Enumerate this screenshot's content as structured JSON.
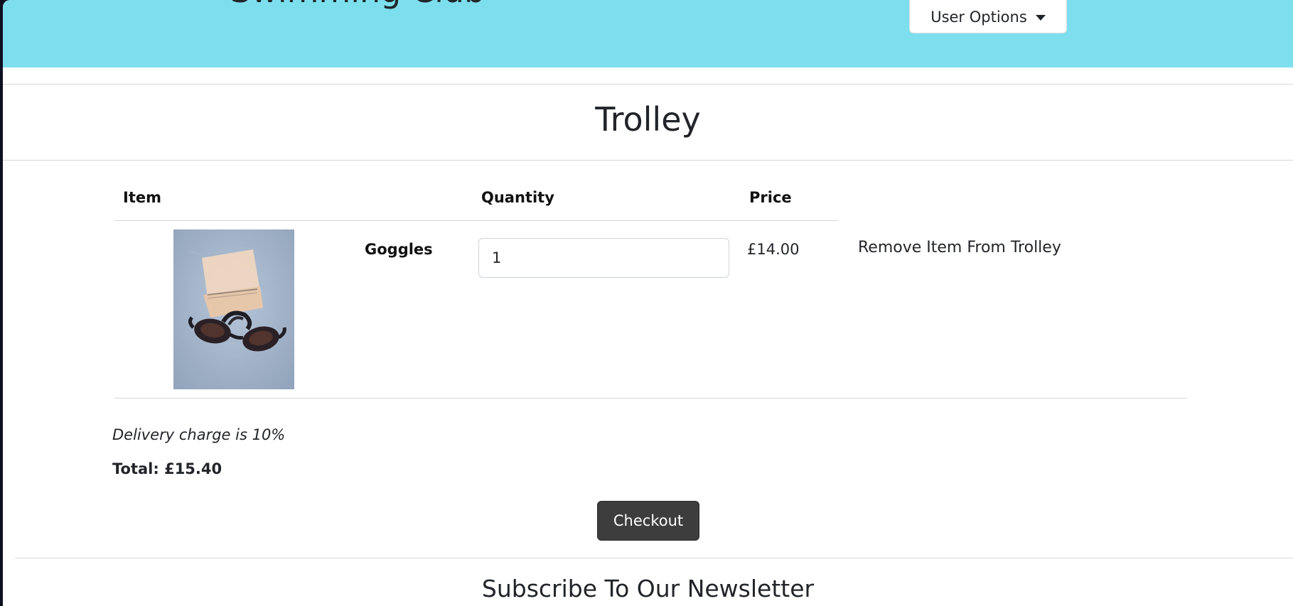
{
  "header": {
    "site_title": "Swimming Club",
    "user_options_label": "User Options"
  },
  "trolley": {
    "heading": "Trolley",
    "columns": {
      "item": "Item",
      "quantity": "Quantity",
      "price": "Price"
    },
    "items": [
      {
        "name": "Goggles",
        "quantity": "1",
        "price": "£14.00",
        "remove_label": "Remove Item From Trolley",
        "image_icon": "goggles-product-photo"
      }
    ],
    "delivery_note": "Delivery charge is 10%",
    "total": "Total: £15.40",
    "checkout_label": "Checkout"
  },
  "newsletter": {
    "heading": "Subscribe To Our Newsletter"
  },
  "colors": {
    "header_bg": "#7ddfed",
    "checkout_bg": "#3d3d3d",
    "page_bg": "#ffffff"
  }
}
